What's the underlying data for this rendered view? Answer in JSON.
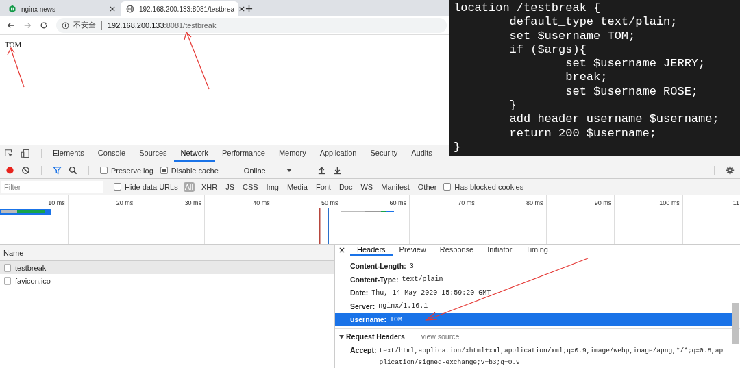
{
  "browser_tabs": [
    {
      "title": "nginx news",
      "selected": false
    },
    {
      "title": "192.168.200.133:8081/testbrea",
      "selected": true
    }
  ],
  "address_bar": {
    "security_label": "不安全",
    "host": "192.168.200.133",
    "path": ":8081/testbreak"
  },
  "page": {
    "body_text": "TOM"
  },
  "code_overlay": {
    "lines": [
      "location /testbreak {",
      "        default_type text/plain;",
      "        set $username TOM;",
      "        if ($args){",
      "                set $username JERRY;",
      "                break;",
      "                set $username ROSE;",
      "        }",
      "        add_header username $username;",
      "        return 200 $username;",
      "}"
    ]
  },
  "devtools": {
    "tabs": [
      {
        "label": "Elements",
        "selected": false
      },
      {
        "label": "Console",
        "selected": false
      },
      {
        "label": "Sources",
        "selected": false
      },
      {
        "label": "Network",
        "selected": true
      },
      {
        "label": "Performance",
        "selected": false
      },
      {
        "label": "Memory",
        "selected": false
      },
      {
        "label": "Application",
        "selected": false
      },
      {
        "label": "Security",
        "selected": false
      },
      {
        "label": "Audits",
        "selected": false
      }
    ],
    "toolbar": {
      "recording": true,
      "filter_active": true,
      "preserve_log": {
        "label": "Preserve log",
        "checked": false
      },
      "disable_cache": {
        "label": "Disable cache",
        "checked": true
      },
      "throttling": "Online"
    },
    "filter_bar": {
      "placeholder": "Filter",
      "hide_data_urls": {
        "label": "Hide data URLs",
        "checked": false
      },
      "types": [
        {
          "label": "All",
          "selected": true
        },
        {
          "label": "XHR",
          "selected": false
        },
        {
          "label": "JS",
          "selected": false
        },
        {
          "label": "CSS",
          "selected": false
        },
        {
          "label": "Img",
          "selected": false
        },
        {
          "label": "Media",
          "selected": false
        },
        {
          "label": "Font",
          "selected": false
        },
        {
          "label": "Doc",
          "selected": false
        },
        {
          "label": "WS",
          "selected": false
        },
        {
          "label": "Manifest",
          "selected": false
        },
        {
          "label": "Other",
          "selected": false
        }
      ],
      "has_blocked_cookies": {
        "label": "Has blocked cookies",
        "checked": false
      }
    },
    "timeline": {
      "ticks": [
        "10 ms",
        "20 ms",
        "30 ms",
        "40 ms",
        "50 ms",
        "60 ms",
        "70 ms",
        "80 ms",
        "90 ms",
        "100 ms",
        "11"
      ]
    }
  },
  "requests": {
    "column": "Name",
    "rows": [
      {
        "name": "testbreak",
        "selected": true
      },
      {
        "name": "favicon.ico",
        "selected": false
      }
    ]
  },
  "details": {
    "tabs": [
      {
        "label": "Headers",
        "selected": true
      },
      {
        "label": "Preview",
        "selected": false
      },
      {
        "label": "Response",
        "selected": false
      },
      {
        "label": "Initiator",
        "selected": false
      },
      {
        "label": "Timing",
        "selected": false
      }
    ],
    "response_headers": [
      {
        "name": "Content-Length:",
        "value": "3",
        "selected": false
      },
      {
        "name": "Content-Type:",
        "value": "text/plain",
        "selected": false
      },
      {
        "name": "Date:",
        "value": "Thu, 14 May 2020 15:59:20 GMT",
        "selected": false
      },
      {
        "name": "Server:",
        "value": "nginx/1.16.1",
        "selected": false
      },
      {
        "name": "username:",
        "value": "TOM",
        "selected": true
      }
    ],
    "request_headers": {
      "title": "Request Headers",
      "expanded": true,
      "view_source": "view source",
      "headers": [
        {
          "name": "Accept:",
          "lines": [
            "text/html,application/xhtml+xml,application/xml;q=0.9,image/webp,image/apng,*/*;q=0.8,ap",
            "plication/signed-exchange;v=b3;q=0.9"
          ]
        }
      ]
    }
  }
}
